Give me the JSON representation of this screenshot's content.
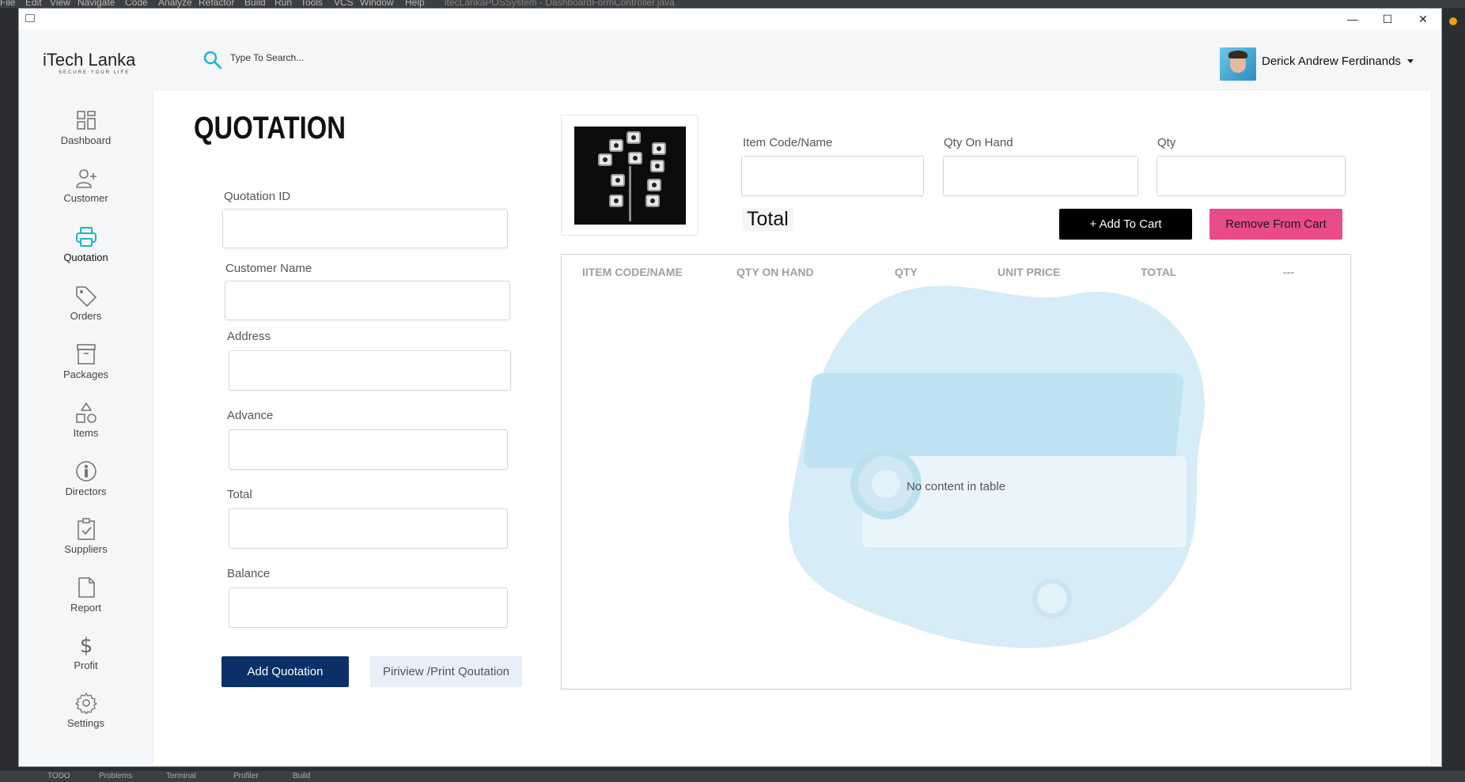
{
  "ide": {
    "menu": [
      "File",
      "Edit",
      "View",
      "Navigate",
      "Code",
      "Analyze",
      "Refactor",
      "Build",
      "Run",
      "Tools",
      "VCS",
      "Window",
      "Help"
    ],
    "window_title": "itecLankaPOSSystem - DashboardFormController.java",
    "bottom_tabs": [
      "TODO",
      "Problems",
      "Terminal",
      "Profiler",
      "Build"
    ]
  },
  "window": {
    "minimize": "—",
    "maximize": "☐",
    "close": "✕"
  },
  "header": {
    "logo": "iTech Lanka",
    "logo_tagline": "SECURE YOUR LIFE",
    "search_placeholder": "Type To Search...",
    "user_name": "Derick Andrew Ferdinands"
  },
  "sidebar": {
    "items": [
      {
        "label": "Dashboard",
        "icon": "dashboard-icon"
      },
      {
        "label": "Customer",
        "icon": "add-user-icon"
      },
      {
        "label": "Quotation",
        "icon": "printer-icon",
        "active": true
      },
      {
        "label": "Orders",
        "icon": "tag-icon"
      },
      {
        "label": "Packages",
        "icon": "archive-icon"
      },
      {
        "label": "Items",
        "icon": "shapes-icon"
      },
      {
        "label": "Directors",
        "icon": "person-icon"
      },
      {
        "label": "Suppliers",
        "icon": "clipboard-check-icon"
      },
      {
        "label": "Report",
        "icon": "document-icon"
      },
      {
        "label": "Profit",
        "icon": "dollar-icon"
      },
      {
        "label": "Settings",
        "icon": "gear-icon"
      }
    ],
    "active_color": "#1ab5c9"
  },
  "form": {
    "title": "QUOTATION",
    "quotation_id_label": "Quotation ID",
    "quotation_id_value": "",
    "customer_name_label": "Customer Name",
    "customer_name_value": "",
    "address_label": "Address",
    "address_value": "",
    "advance_label": "Advance",
    "advance_value": "",
    "total_label": "Total",
    "total_value": "",
    "balance_label": "Balance",
    "balance_value": "",
    "add_button": "Add Quotation",
    "print_button": "Piriview /Print Qoutation"
  },
  "item": {
    "code_label": "Item Code/Name",
    "code_value": "",
    "qoh_label": "Qty On Hand",
    "qoh_value": "",
    "qty_label": "Qty",
    "qty_value": "",
    "total_label": "Total",
    "add_to_cart": "+ Add To Cart",
    "remove_from_cart": "Remove From Cart"
  },
  "table": {
    "columns": [
      "IITEM CODE/NAME",
      "QTY ON HAND",
      "QTY",
      "UNIT PRICE",
      "TOTAL",
      "---"
    ],
    "rows": [],
    "empty_message": "No content in table"
  },
  "colors": {
    "primary_button": "#0b3068",
    "secondary_button": "#e7eff9",
    "cart_add": "#000000",
    "cart_remove": "#e84a8a",
    "watermark": "#d6ecf6"
  }
}
